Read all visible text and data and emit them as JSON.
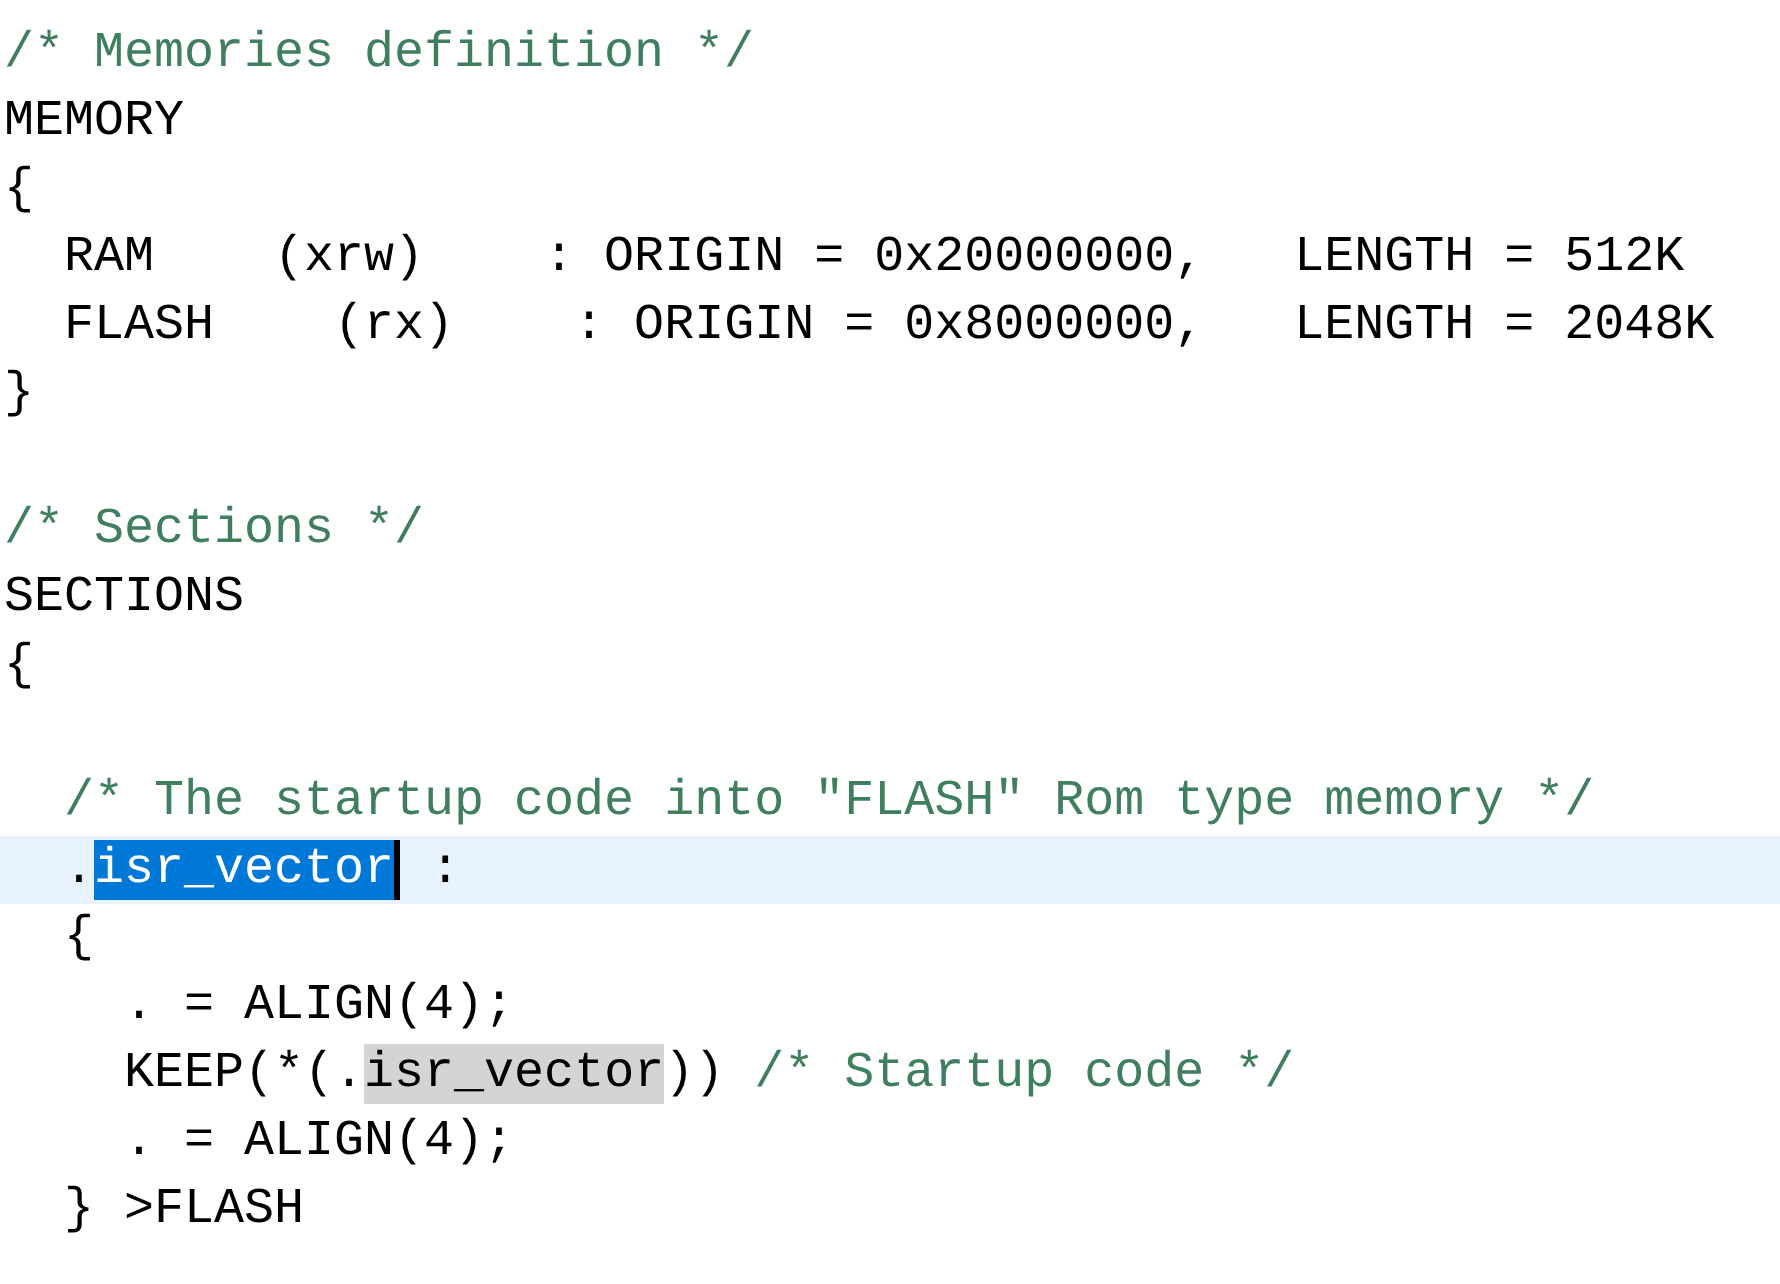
{
  "editor": {
    "lines": [
      {
        "current": false,
        "segments": [
          {
            "kind": "comment",
            "text": "/* Memories definition */"
          }
        ]
      },
      {
        "current": false,
        "segments": [
          {
            "kind": "code",
            "text": "MEMORY"
          }
        ]
      },
      {
        "current": false,
        "segments": [
          {
            "kind": "code",
            "text": "{"
          }
        ]
      },
      {
        "current": false,
        "segments": [
          {
            "kind": "code",
            "text": "  RAM    (xrw)    : ORIGIN = 0x20000000,   LENGTH = 512K"
          }
        ]
      },
      {
        "current": false,
        "segments": [
          {
            "kind": "code",
            "text": "  FLASH    (rx)    : ORIGIN = 0x8000000,   LENGTH = 2048K"
          }
        ]
      },
      {
        "current": false,
        "segments": [
          {
            "kind": "code",
            "text": "}"
          }
        ]
      },
      {
        "current": false
      },
      {
        "current": false,
        "segments": [
          {
            "kind": "comment",
            "text": "/* Sections */"
          }
        ]
      },
      {
        "current": false,
        "segments": [
          {
            "kind": "code",
            "text": "SECTIONS"
          }
        ]
      },
      {
        "current": false,
        "segments": [
          {
            "kind": "code",
            "text": "{"
          }
        ]
      },
      {
        "current": false
      },
      {
        "current": false,
        "segments": [
          {
            "kind": "comment",
            "text": "  /* The startup code into \"FLASH\" Rom type memory */"
          }
        ]
      },
      {
        "current": true,
        "segments": [
          {
            "kind": "code",
            "text": "  ."
          },
          {
            "kind": "selection",
            "text": "isr_vector"
          },
          {
            "kind": "caret"
          },
          {
            "kind": "code",
            "text": " :"
          }
        ]
      },
      {
        "current": false,
        "segments": [
          {
            "kind": "code",
            "text": "  {"
          }
        ]
      },
      {
        "current": false,
        "segments": [
          {
            "kind": "code",
            "text": "    . = ALIGN(4);"
          }
        ]
      },
      {
        "current": false,
        "segments": [
          {
            "kind": "code",
            "text": "    KEEP(*(."
          },
          {
            "kind": "occurrence",
            "text": "isr_vector"
          },
          {
            "kind": "code",
            "text": "))"
          },
          {
            "kind": "comment",
            "text": " /* Startup code */"
          }
        ]
      },
      {
        "current": false,
        "segments": [
          {
            "kind": "code",
            "text": "    . = ALIGN(4);"
          }
        ]
      },
      {
        "current": false,
        "segments": [
          {
            "kind": "code",
            "text": "  } >FLASH"
          }
        ]
      }
    ]
  }
}
